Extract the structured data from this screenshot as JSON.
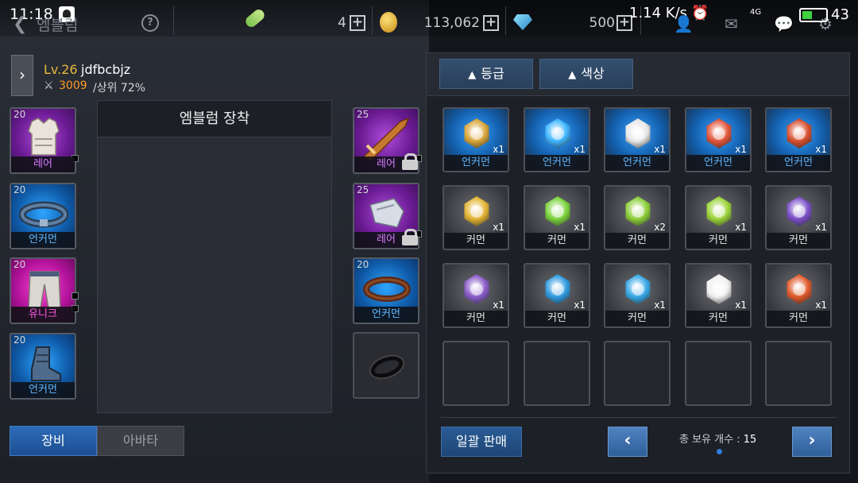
{
  "status_bar": {
    "time": "11:18",
    "net_speed": "1.14 K/s",
    "signal": "4G",
    "battery": "43"
  },
  "header": {
    "title": "엠블럼",
    "currencies": [
      {
        "icon": "energy-item-icon",
        "value": "4"
      },
      {
        "icon": "gold-coin-icon",
        "value": "113,062"
      },
      {
        "icon": "diamond-icon",
        "value": "500"
      }
    ]
  },
  "profile": {
    "level": "Lv.26",
    "name": "jdfbcbjz",
    "power": "3009",
    "rank": "/상위 72%"
  },
  "equipment": {
    "left_slots": [
      {
        "level": "20",
        "grade": "레어",
        "item": "chest-armor"
      },
      {
        "level": "20",
        "grade": "언커먼",
        "item": "belt"
      },
      {
        "level": "20",
        "grade": "유니크",
        "item": "pants"
      },
      {
        "level": "20",
        "grade": "언커먼",
        "item": "boots"
      }
    ],
    "right_slots": [
      {
        "level": "25",
        "grade": "레어",
        "item": "sword",
        "locked": true
      },
      {
        "level": "25",
        "grade": "레어",
        "item": "gauntlet",
        "locked": true
      },
      {
        "level": "20",
        "grade": "언커먼",
        "item": "necklace"
      },
      {
        "level": "",
        "grade": "",
        "item": "ring-empty"
      }
    ]
  },
  "center_panel": {
    "title": "엠블럼 장착"
  },
  "tabs": {
    "equip": "장비",
    "avatar": "아바타"
  },
  "inventory": {
    "filters": [
      "등급",
      "색상"
    ],
    "filter_arrow": "▲",
    "items": [
      {
        "grade": "언커먼",
        "qty": "x1",
        "color": "#d9a63a"
      },
      {
        "grade": "언커먼",
        "qty": "x1",
        "color": "#3fb6ff"
      },
      {
        "grade": "언커먼",
        "qty": "x1",
        "color": "#e8e8e8"
      },
      {
        "grade": "언커먼",
        "qty": "x1",
        "color": "#e2563a"
      },
      {
        "grade": "언커먼",
        "qty": "x1",
        "color": "#d8502f"
      },
      {
        "grade": "커먼",
        "qty": "x1",
        "color": "#e3b433"
      },
      {
        "grade": "커먼",
        "qty": "x1",
        "color": "#7bd33d"
      },
      {
        "grade": "커먼",
        "qty": "x2",
        "color": "#8ccf3a"
      },
      {
        "grade": "커먼",
        "qty": "x1",
        "color": "#9bd43a"
      },
      {
        "grade": "커먼",
        "qty": "x1",
        "color": "#7a4fc7"
      },
      {
        "grade": "커먼",
        "qty": "x1",
        "color": "#8a5cc9"
      },
      {
        "grade": "커먼",
        "qty": "x1",
        "color": "#2f9ae0"
      },
      {
        "grade": "커먼",
        "qty": "x1",
        "color": "#37a8e6"
      },
      {
        "grade": "커먼",
        "qty": "x1",
        "color": "#f0f0f0"
      },
      {
        "grade": "커먼",
        "qty": "x1",
        "color": "#e05a2c"
      }
    ],
    "bulk_sell": "일괄 판매",
    "prev": "‹",
    "next": "›",
    "total_label": "총 보유 개수 : ",
    "total_value": "15"
  }
}
